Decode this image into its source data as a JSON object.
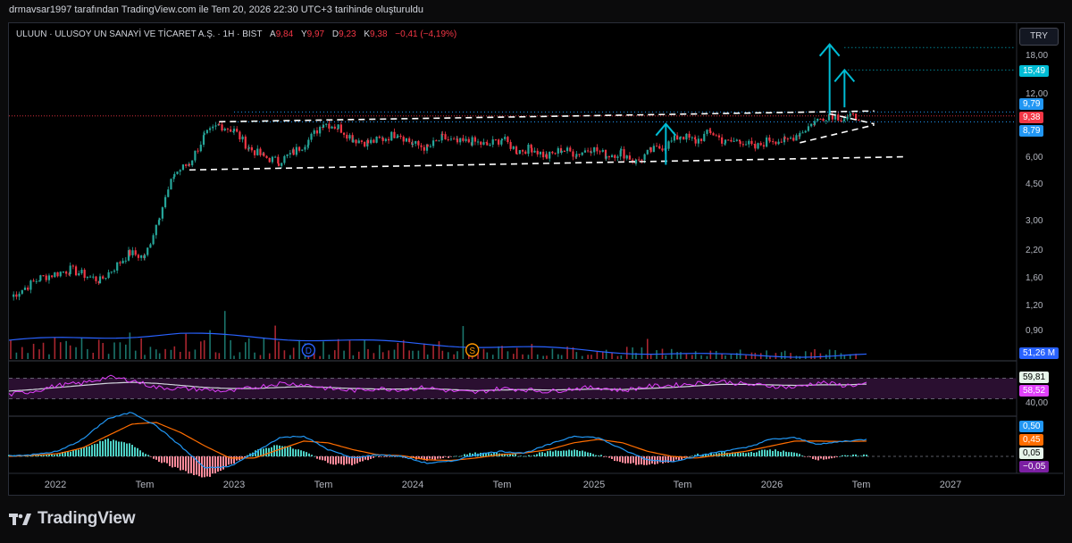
{
  "header": {
    "caption": "drmavsar1997 tarafından TradingView.com ile Tem 20, 2026 22:30 UTC+3 tarihinde oluşturuldu"
  },
  "legend": {
    "symbol": "ULUUN · ULUSOY UN SANAYİ VE TİCARET A.Ş. · 1H · BIST",
    "o_label": "A",
    "o": "9,84",
    "h_label": "Y",
    "h": "9,97",
    "l_label": "D",
    "l": "9,23",
    "c_label": "K",
    "c": "9,38",
    "change": "−0,41 (−4,19%)"
  },
  "currency": "TRY",
  "footer": {
    "brand": "TradingView"
  },
  "colors": {
    "up": "#26a69a",
    "down": "#f23645",
    "volume_ma": "#2962ff",
    "rsi": "#e040fb",
    "rsi_ma": "#d1d4dc",
    "macd": "#2196f3",
    "signal": "#ff6d00",
    "arrows": "#00bcd4",
    "hist_pos": "#4dd0c4",
    "hist_neg": "#ff8a9a"
  },
  "chart_data": [
    {
      "type": "candlestick",
      "title": "ULUUN · ULUSOY UN SANAYİ VE TİCARET A.Ş. · 1H · BIST",
      "yscale": "log",
      "price_ticks": [
        "18,00",
        "12,00",
        "6,00",
        "4,50",
        "3,00",
        "2,20",
        "1,60",
        "1,20",
        "0,90"
      ],
      "x_ticks": [
        "2022",
        "Tem",
        "2023",
        "Tem",
        "2024",
        "Tem",
        "2025",
        "Tem",
        "2026",
        "Tem",
        "2027"
      ],
      "x_tick_dates": [
        "2022-01",
        "2022-07",
        "2023-01",
        "2023-07",
        "2024-01",
        "2024-07",
        "2025-01",
        "2025-07",
        "2026-01",
        "2026-07",
        "2027-01"
      ],
      "price_series": [
        {
          "date": "2021-10",
          "close": 1.3
        },
        {
          "date": "2021-12",
          "close": 1.6
        },
        {
          "date": "2022-02",
          "close": 1.75
        },
        {
          "date": "2022-04",
          "close": 1.55
        },
        {
          "date": "2022-06",
          "close": 2.1
        },
        {
          "date": "2022-07",
          "close": 2.0
        },
        {
          "date": "2022-08",
          "close": 3.2
        },
        {
          "date": "2022-09",
          "close": 5.0
        },
        {
          "date": "2022-10",
          "close": 5.6
        },
        {
          "date": "2022-11",
          "close": 7.5
        },
        {
          "date": "2022-12",
          "close": 8.5
        },
        {
          "date": "2023-01",
          "close": 8.0
        },
        {
          "date": "2023-02",
          "close": 6.6
        },
        {
          "date": "2023-03",
          "close": 6.0
        },
        {
          "date": "2023-04",
          "close": 5.7
        },
        {
          "date": "2023-05",
          "close": 6.3
        },
        {
          "date": "2023-06",
          "close": 7.2
        },
        {
          "date": "2023-07",
          "close": 8.7
        },
        {
          "date": "2023-08",
          "close": 8.3
        },
        {
          "date": "2023-09",
          "close": 7.3
        },
        {
          "date": "2023-10",
          "close": 7.0
        },
        {
          "date": "2023-11",
          "close": 7.3
        },
        {
          "date": "2023-12",
          "close": 7.8
        },
        {
          "date": "2024-01",
          "close": 6.9
        },
        {
          "date": "2024-02",
          "close": 6.6
        },
        {
          "date": "2024-03",
          "close": 7.4
        },
        {
          "date": "2024-04",
          "close": 7.0
        },
        {
          "date": "2024-05",
          "close": 7.1
        },
        {
          "date": "2024-06",
          "close": 6.8
        },
        {
          "date": "2024-07",
          "close": 7.3
        },
        {
          "date": "2024-08",
          "close": 6.4
        },
        {
          "date": "2024-09",
          "close": 6.6
        },
        {
          "date": "2024-10",
          "close": 6.0
        },
        {
          "date": "2024-11",
          "close": 6.5
        },
        {
          "date": "2024-12",
          "close": 6.2
        },
        {
          "date": "2025-01",
          "close": 6.6
        },
        {
          "date": "2025-02",
          "close": 6.1
        },
        {
          "date": "2025-03",
          "close": 6.3
        },
        {
          "date": "2025-04",
          "close": 5.7
        },
        {
          "date": "2025-05",
          "close": 6.4
        },
        {
          "date": "2025-06",
          "close": 6.8
        },
        {
          "date": "2025-07",
          "close": 7.6
        },
        {
          "date": "2025-08",
          "close": 7.1
        },
        {
          "date": "2025-09",
          "close": 7.9
        },
        {
          "date": "2025-10",
          "close": 7.0
        },
        {
          "date": "2025-11",
          "close": 7.2
        },
        {
          "date": "2025-12",
          "close": 6.6
        },
        {
          "date": "2026-01",
          "close": 7.3
        },
        {
          "date": "2026-02",
          "close": 7.1
        },
        {
          "date": "2026-03",
          "close": 7.8
        },
        {
          "date": "2026-04",
          "close": 8.8
        },
        {
          "date": "2026-05",
          "close": 9.6
        },
        {
          "date": "2026-06",
          "close": 9.1
        },
        {
          "date": "2026-07",
          "close": 9.38
        }
      ],
      "price_tags": [
        {
          "label": "15,49",
          "value": 15.49,
          "color": "#00bcd4"
        },
        {
          "label": "9,79",
          "value": 9.79,
          "color": "#2196f3"
        },
        {
          "label": "9,38",
          "value": 9.38,
          "color": "#f23645"
        },
        {
          "label": "8,79",
          "value": 8.79,
          "color": "#2196f3"
        }
      ],
      "horizontal_levels": [
        19.8,
        15.49,
        9.79,
        8.79,
        9.38
      ],
      "trendlines": [
        {
          "from": {
            "date": "2022-12",
            "price": 8.8
          },
          "to": {
            "date": "2026-08",
            "price": 9.9
          }
        },
        {
          "from": {
            "date": "2022-10",
            "price": 5.2
          },
          "to": {
            "date": "2026-10",
            "price": 6.0
          }
        },
        {
          "from": {
            "date": "2026-03",
            "price": 7.0
          },
          "to": {
            "date": "2026-08",
            "price": 8.5
          }
        },
        {
          "from": {
            "date": "2026-05",
            "price": 9.6
          },
          "to": {
            "date": "2026-08",
            "price": 8.6
          }
        }
      ],
      "arrows": [
        {
          "date": "2025-06",
          "from": 5.5,
          "to": 8.6
        },
        {
          "date": "2026-05",
          "from": 9.6,
          "to": 20.5
        },
        {
          "date": "2026-06",
          "from": 10.3,
          "to": 15.49
        }
      ],
      "volume": {
        "label": "51,26 M",
        "events": [
          {
            "date": "2023-06",
            "label": "D"
          },
          {
            "date": "2024-05",
            "label": "S"
          }
        ]
      }
    },
    {
      "type": "line",
      "title": "RSI",
      "yticks": [
        "59,81",
        "40,00"
      ],
      "tag_values": [
        "59,81",
        "58,52"
      ],
      "levels": [
        70,
        30
      ],
      "series": [
        {
          "key": "rsi",
          "values": [
            38,
            45,
            56,
            60,
            72,
            66,
            52,
            50,
            48,
            44,
            52,
            60,
            58,
            50,
            46,
            50,
            48,
            52,
            45,
            42,
            50,
            48,
            44,
            50,
            52,
            46,
            54,
            56,
            60,
            64,
            58,
            55,
            52,
            62,
            56,
            58
          ]
        },
        {
          "key": "rsi_ma",
          "values": [
            45,
            48,
            52,
            56,
            60,
            62,
            60,
            56,
            52,
            50,
            50,
            52,
            54,
            52,
            50,
            49,
            49,
            50,
            48,
            46,
            47,
            48,
            47,
            48,
            49,
            48,
            50,
            52,
            55,
            58,
            58,
            57,
            56,
            57,
            57,
            58.5
          ]
        }
      ]
    },
    {
      "type": "line",
      "title": "MACD",
      "yticks": [
        "0,50",
        "0,45",
        "0,05",
        "−0,05"
      ],
      "tag_values": [
        "0,50",
        "0,45",
        "0,05",
        "−0,05"
      ],
      "series": [
        {
          "key": "macd",
          "values": [
            0.02,
            0.05,
            0.15,
            0.5,
            1.1,
            1.3,
            0.9,
            0.3,
            -0.35,
            -0.3,
            0.1,
            0.55,
            0.6,
            0.2,
            -0.05,
            0.05,
            0.0,
            -0.2,
            -0.15,
            0.05,
            0.15,
            0.1,
            0.35,
            0.6,
            0.55,
            0.2,
            -0.1,
            -0.15,
            0.0,
            0.15,
            0.25,
            0.5,
            0.55,
            0.35,
            0.45,
            0.5
          ]
        },
        {
          "key": "signal",
          "values": [
            0.0,
            0.03,
            0.08,
            0.25,
            0.6,
            0.95,
            1.0,
            0.7,
            0.3,
            -0.05,
            -0.05,
            0.2,
            0.45,
            0.4,
            0.2,
            0.05,
            0.02,
            -0.1,
            -0.12,
            -0.05,
            0.05,
            0.1,
            0.2,
            0.4,
            0.5,
            0.4,
            0.15,
            0.0,
            -0.05,
            0.05,
            0.15,
            0.3,
            0.45,
            0.45,
            0.44,
            0.45
          ]
        },
        {
          "key": "hist",
          "values": [
            0.02,
            0.02,
            0.07,
            0.25,
            0.5,
            0.35,
            -0.1,
            -0.4,
            -0.65,
            -0.25,
            0.15,
            0.35,
            0.15,
            -0.2,
            -0.25,
            0.0,
            -0.02,
            -0.1,
            -0.03,
            0.1,
            0.1,
            0.0,
            0.15,
            0.2,
            0.05,
            -0.2,
            -0.25,
            -0.15,
            0.05,
            0.1,
            0.1,
            0.2,
            0.1,
            -0.1,
            0.01,
            0.05
          ]
        }
      ]
    }
  ]
}
